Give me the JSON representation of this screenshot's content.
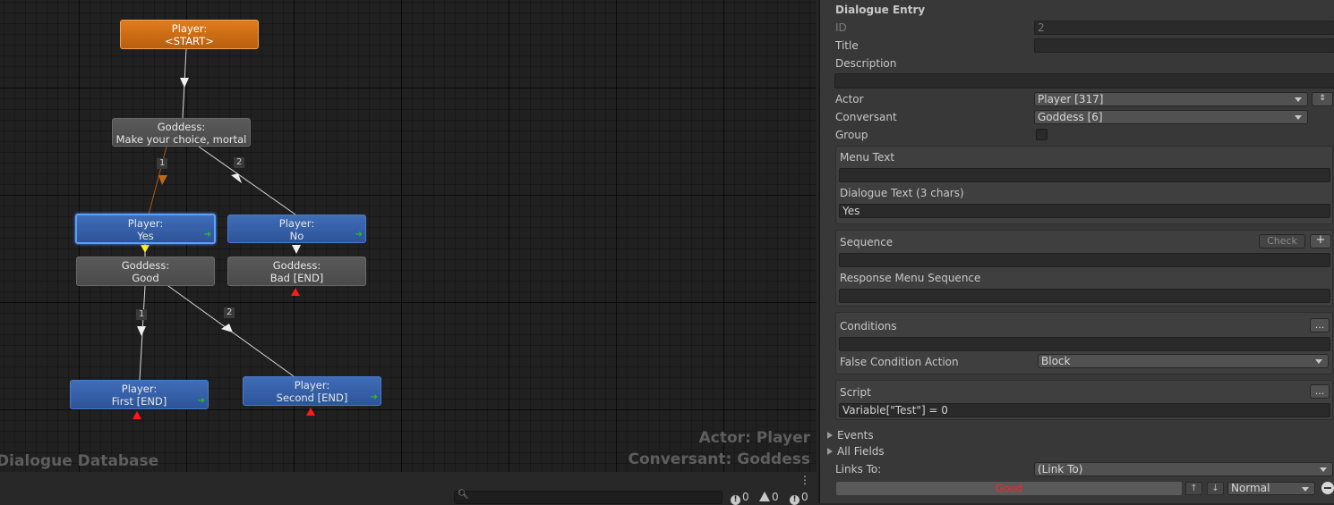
{
  "graph": {
    "nodes": [
      {
        "id": "start",
        "actor": "Player:",
        "text": "<START>"
      },
      {
        "id": "goddess-choice",
        "actor": "Goddess:",
        "text": "Make your choice, mortal"
      },
      {
        "id": "player-yes",
        "actor": "Player:",
        "text": "Yes"
      },
      {
        "id": "player-no",
        "actor": "Player:",
        "text": "No"
      },
      {
        "id": "goddess-good",
        "actor": "Goddess:",
        "text": "Good"
      },
      {
        "id": "goddess-bad",
        "actor": "Goddess:",
        "text": "Bad [END]"
      },
      {
        "id": "player-first",
        "actor": "Player:",
        "text": "First [END]"
      },
      {
        "id": "player-second",
        "actor": "Player:",
        "text": "Second [END]"
      }
    ],
    "link_badges": [
      "1",
      "2",
      "1",
      "2"
    ],
    "watermark_left": "Dialogue Database",
    "watermark_actor": "Actor: Player",
    "watermark_conversant": "Conversant: Goddess"
  },
  "statusbar": {
    "menu": "⋮",
    "errors": "0",
    "warnings": "0",
    "infos": "0"
  },
  "inspector": {
    "header": "Dialogue Entry",
    "id_label": "ID",
    "id_value": "2",
    "title_label": "Title",
    "title_value": "",
    "description_label": "Description",
    "description_value": "",
    "actor_label": "Actor",
    "actor_value": "Player [317]",
    "conversant_label": "Conversant",
    "conversant_value": "Goddess [6]",
    "group_label": "Group",
    "menu_text_label": "Menu Text",
    "menu_text_value": "",
    "dialogue_text_label": "Dialogue Text (3 chars)",
    "dialogue_text_value": "Yes",
    "sequence_label": "Sequence",
    "check_label": "Check",
    "plus_label": "+",
    "sequence_value": "",
    "response_menu_sequence_label": "Response Menu Sequence",
    "response_menu_sequence_value": "",
    "conditions_label": "Conditions",
    "more_label": "...",
    "conditions_value": "",
    "false_condition_action_label": "False Condition Action",
    "false_condition_action_value": "Block",
    "script_label": "Script",
    "script_value": "Variable[\"Test\"] = 0",
    "events_label": "Events",
    "all_fields_label": "All Fields",
    "links_to_label": "Links To:",
    "links_to_value": "(Link To)",
    "link_target": "Good",
    "link_priority": "Normal",
    "up_arrow": "↑",
    "down_arrow": "↓"
  }
}
